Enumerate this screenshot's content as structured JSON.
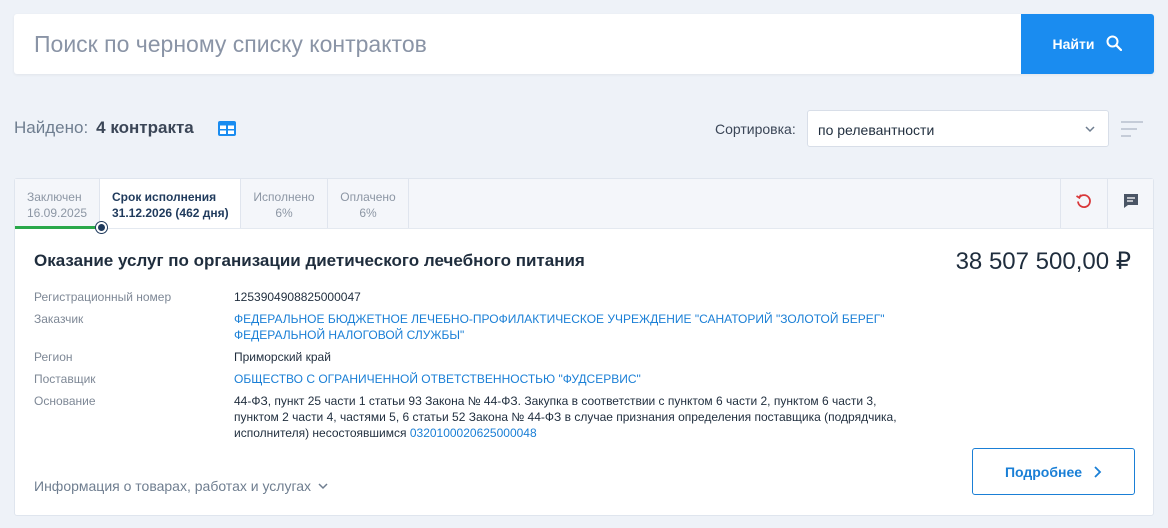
{
  "search": {
    "placeholder": "Поиск по черному списку контрактов",
    "button_label": "Найти"
  },
  "results": {
    "found_label": "Найдено:",
    "count_label": "4 контракта"
  },
  "sort": {
    "label": "Сортировка:",
    "selected": "по релевантности"
  },
  "contract": {
    "tabs": [
      {
        "title": "Заключен",
        "value": "16.09.2025"
      },
      {
        "title": "Срок исполнения",
        "value": "31.12.2026 (462 дня)"
      },
      {
        "title": "Исполнено",
        "value": "6%"
      },
      {
        "title": "Оплачено",
        "value": "6%"
      }
    ],
    "title": "Оказание услуг по организации диетического лечебного питания",
    "price": "38 507 500,00 ₽",
    "fields": {
      "reg_label": "Регистрационный номер",
      "reg_value": "1253904908825000047",
      "customer_label": "Заказчик",
      "customer_line1": "ФЕДЕРАЛЬНОЕ БЮДЖЕТНОЕ ЛЕЧЕБНО-ПРОФИЛАКТИЧЕСКОЕ УЧРЕЖДЕНИЕ \"САНАТОРИЙ \"ЗОЛОТОЙ БЕРЕГ\"",
      "customer_line2": "ФЕДЕРАЛЬНОЙ НАЛОГОВОЙ СЛУЖБЫ\"",
      "region_label": "Регион",
      "region_value": "Приморский край",
      "supplier_label": "Поставщик",
      "supplier_value": "ОБЩЕСТВО С ОГРАНИЧЕННОЙ ОТВЕТСТВЕННОСТЬЮ \"ФУДСЕРВИС\"",
      "basis_label": "Основание",
      "basis_line1": "44-ФЗ, пункт 25 части 1 статьи 93  Закона № 44-ФЗ. Закупка в соответствии с пунктом 6 части 2, пунктом 6 части 3,",
      "basis_line2": "пунктом 2 части 4, частями 5, 6 статьи 52 Закона № 44-ФЗ в случае признания определения поставщика (подрядчика,",
      "basis_line3": "исполнителя) несостоявшимся ",
      "basis_link": "0320100020625000048"
    },
    "goods_label": "Информация о товарах, работах и услугах",
    "more_label": "Подробнее"
  },
  "colors": {
    "accent": "#1a8cf0",
    "link": "#1a7fd6",
    "progress": "#2aa84a",
    "refresh_icon": "#d9383a"
  }
}
